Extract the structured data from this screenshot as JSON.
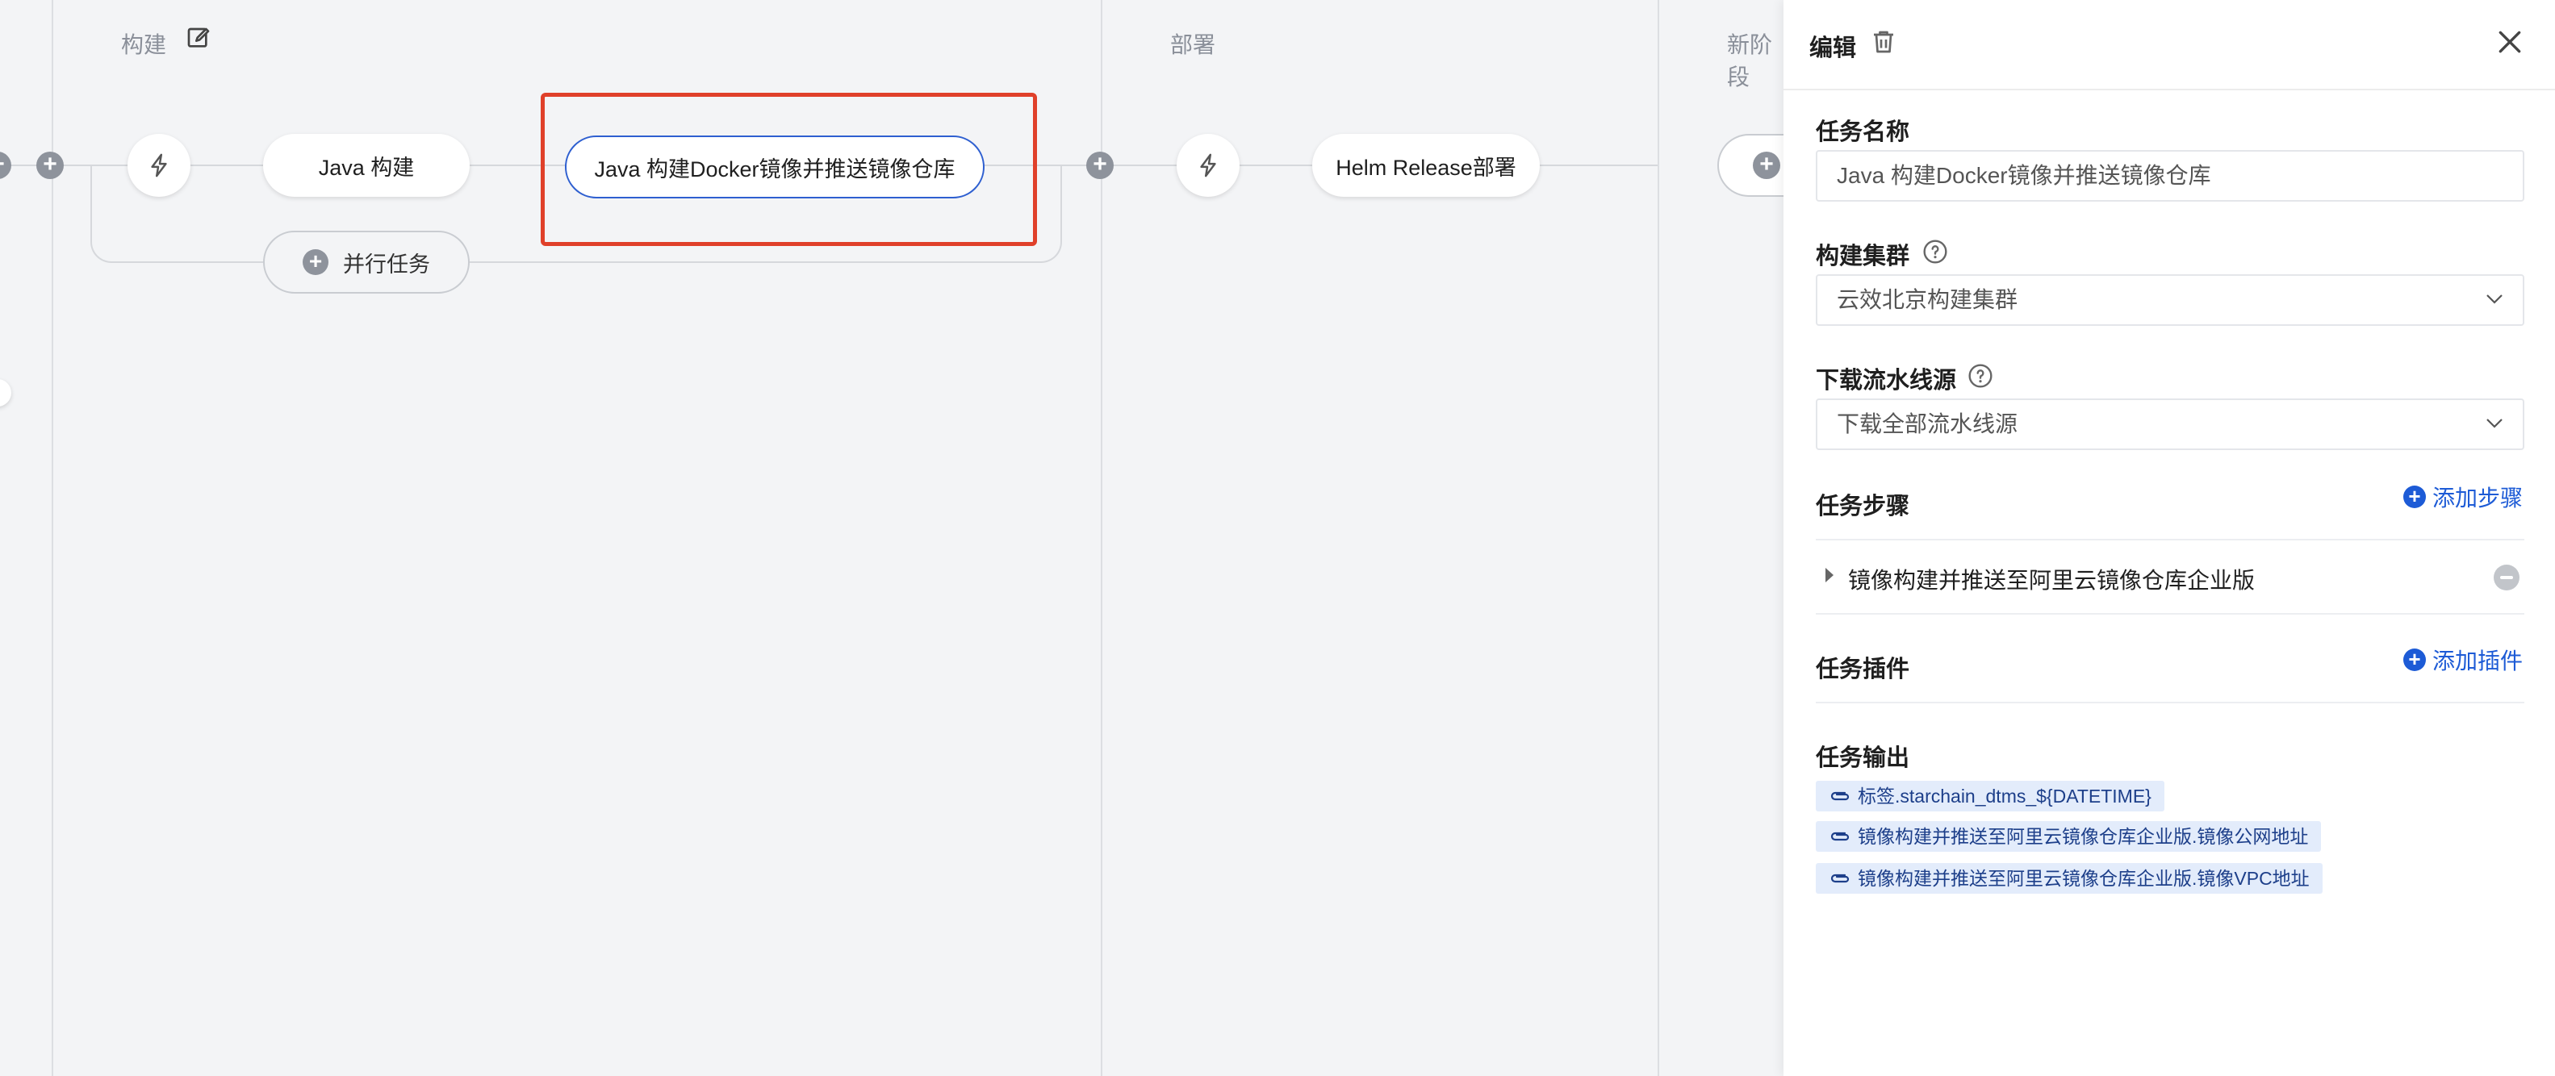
{
  "canvas": {
    "stages": [
      {
        "title": "构建"
      },
      {
        "title": "部署"
      },
      {
        "title": "新阶段"
      }
    ],
    "tasks": {
      "java_build": "Java 构建",
      "docker_push": "Java 构建Docker镜像并推送镜像仓库",
      "helm_deploy": "Helm Release部署"
    },
    "parallel_task_label": "并行任务"
  },
  "panel": {
    "title": "编辑",
    "task_name_label": "任务名称",
    "task_name_value": "Java 构建Docker镜像并推送镜像仓库",
    "cluster_label": "构建集群",
    "cluster_value": "云效北京构建集群",
    "source_label": "下载流水线源",
    "source_value": "下载全部流水线源",
    "steps_label": "任务步骤",
    "add_step_label": "添加步骤",
    "steps": [
      {
        "label": "镜像构建并推送至阿里云镜像仓库企业版"
      }
    ],
    "plugins_label": "任务插件",
    "add_plugin_label": "添加插件",
    "outputs_label": "任务输出",
    "outputs": [
      {
        "label": "标签.starchain_dtms_${DATETIME}"
      },
      {
        "label": "镜像构建并推送至阿里云镜像仓库企业版.镜像公网地址"
      },
      {
        "label": "镜像构建并推送至阿里云镜像仓库企业版.镜像VPC地址"
      }
    ]
  },
  "colors": {
    "accent": "#1d5bd6",
    "selection_highlight": "#e0402a",
    "tag_background": "#e3ecfb"
  }
}
